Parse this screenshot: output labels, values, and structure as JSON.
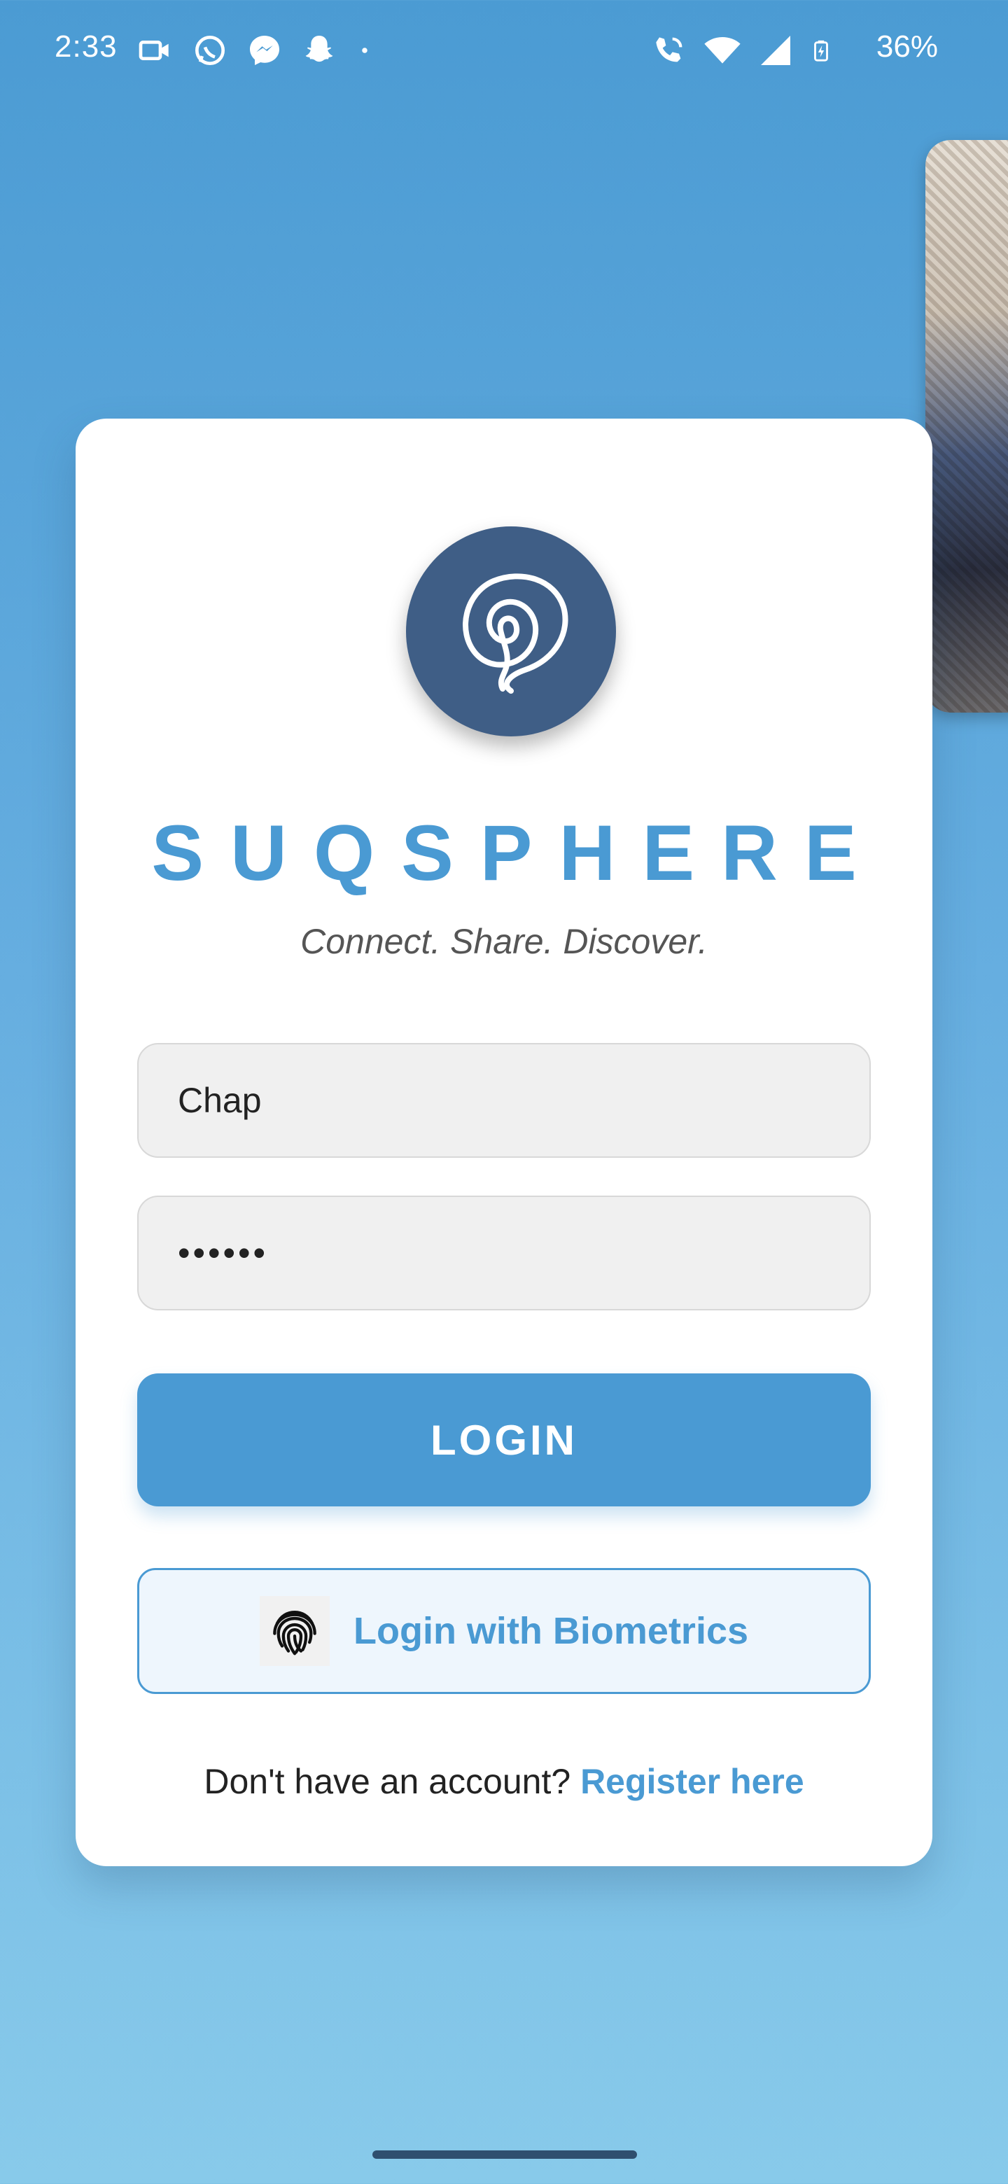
{
  "status_bar": {
    "time": "2:33",
    "battery": "36%",
    "left_icons": [
      "video-call-icon",
      "whatsapp-icon",
      "messenger-icon",
      "snapchat-icon",
      "dot-icon"
    ],
    "right_icons": [
      "wifi-calling-icon",
      "wifi-icon",
      "signal-icon",
      "battery-charging-icon"
    ]
  },
  "app": {
    "brand": "SUQSPHERE",
    "tagline": "Connect. Share. Discover.",
    "username_value": "Chap",
    "password_value": "••••••",
    "login_label": "LOGIN",
    "biometric_label": "Login with Biometrics",
    "register_prompt": "Don't have an account?",
    "register_link": "Register here"
  },
  "colors": {
    "accent": "#4a9ad3",
    "logo_bg": "#3f5e86",
    "background_top": "#4b9bd3",
    "background_bottom": "#88caea"
  }
}
